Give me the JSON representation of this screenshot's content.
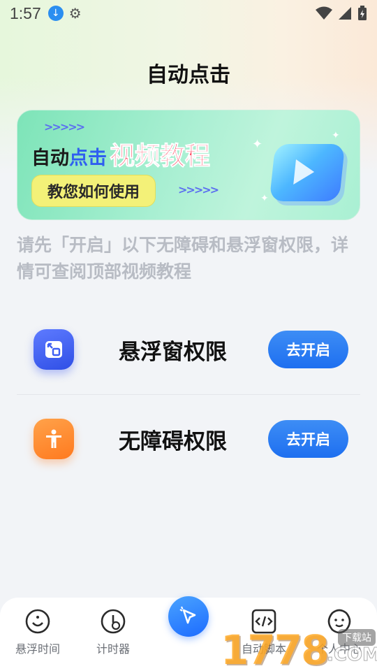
{
  "status": {
    "time": "1:57",
    "download_icon": "download-icon",
    "gear_icon": "gear-icon"
  },
  "page": {
    "title": "自动点击"
  },
  "banner": {
    "headline_part1": "自动",
    "headline_part2": "点击",
    "headline_part3": "视频教程",
    "pill": "教您如何使用",
    "arrows": ">>>>>"
  },
  "hint": "请先「开启」以下无障碍和悬浮窗权限，详情可查阅顶部视频教程",
  "permissions": [
    {
      "label": "悬浮窗权限",
      "button": "去开启",
      "icon": "floating-window-icon",
      "color": "#3e5ff3"
    },
    {
      "label": "无障碍权限",
      "button": "去开启",
      "icon": "accessibility-icon",
      "color": "#ff8a2e"
    }
  ],
  "tabs": [
    {
      "label": "悬浮时间",
      "icon": "clock-icon"
    },
    {
      "label": "计时器",
      "icon": "timer-icon"
    },
    {
      "label": "",
      "icon": "cursor-click-icon"
    },
    {
      "label": "自动脚本",
      "icon": "code-icon"
    },
    {
      "label": "个人中心",
      "icon": "profile-icon"
    }
  ],
  "watermark": {
    "number": "1778",
    "domain": ".COM",
    "tag": "下载站"
  },
  "colors": {
    "accent": "#1e6ff0",
    "banner_green": "#a8efd2",
    "pill_yellow": "#f3f178",
    "hint_gray": "#b8bcc4"
  }
}
